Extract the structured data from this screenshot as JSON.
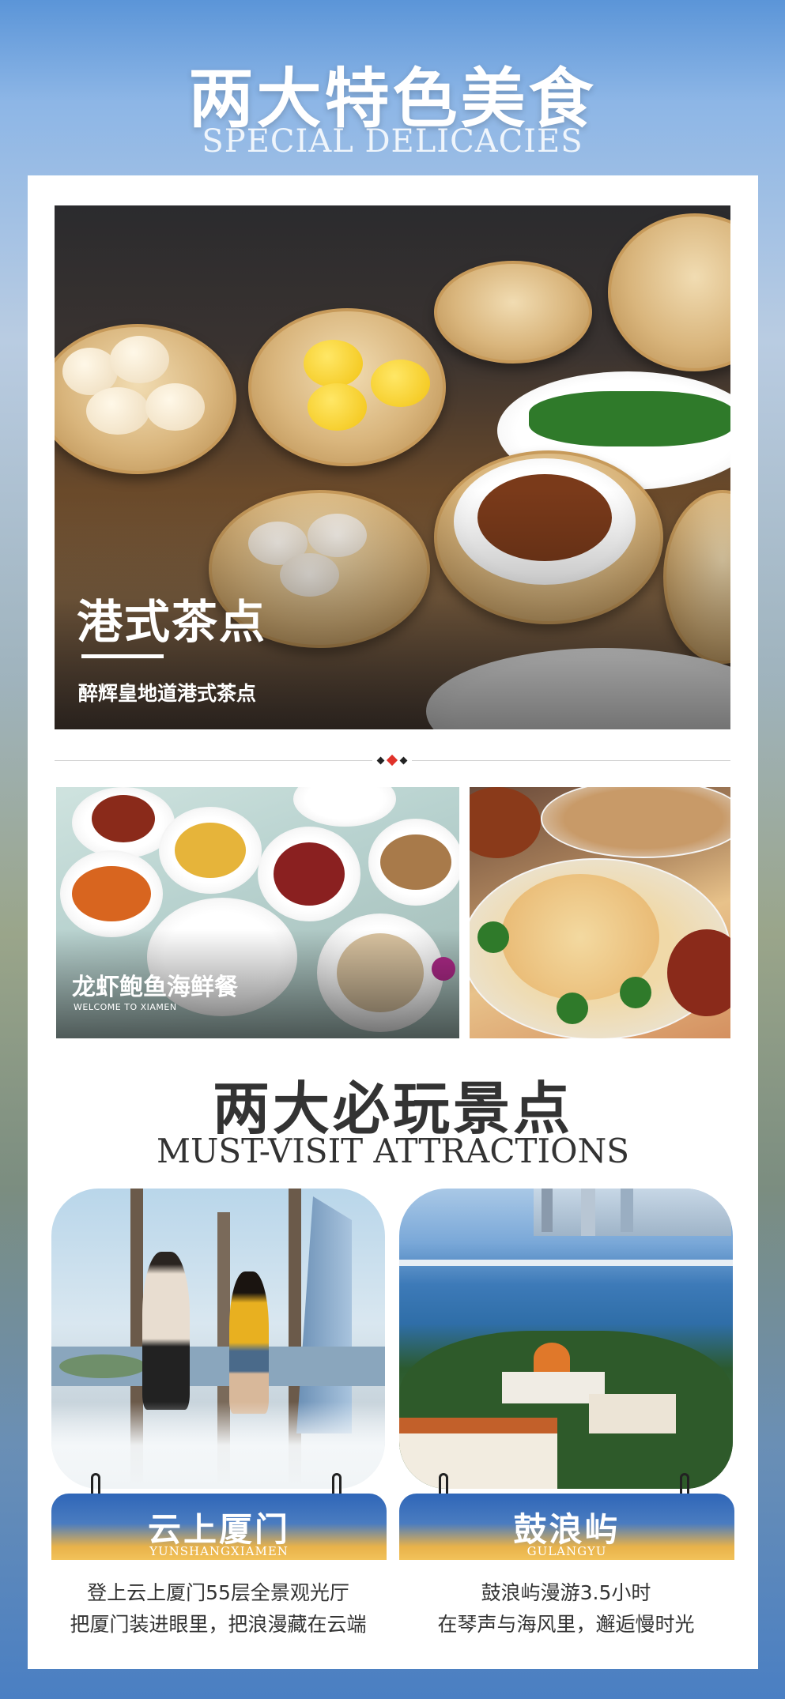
{
  "header": {
    "title": "两大特色美食",
    "subtitle": "SPECIAL DELICACIES"
  },
  "dimsum": {
    "title": "港式茶点",
    "description": "醉辉皇地道港式茶点"
  },
  "seafood": {
    "title": "龙虾鲍鱼海鲜餐",
    "subtitle": "WELCOME TO XIAMEN"
  },
  "attractions": {
    "title": "两大必玩景点",
    "subtitle": "MUST-VISIT ATTRACTIONS",
    "items": [
      {
        "name": "云上厦门",
        "name_en": "YUNSHANGXIAMEN",
        "line1": "登上云上厦门55层全景观光厅",
        "line2": "把厦门装进眼里，把浪漫藏在云端"
      },
      {
        "name": "鼓浪屿",
        "name_en": "GULANGYU",
        "line1": "鼓浪屿漫游3.5小时",
        "line2": "在琴声与海风里，邂逅慢时光"
      }
    ]
  },
  "colors": {
    "accent_red": "#e0322a",
    "banner_blue": "#2f66b8",
    "banner_gold": "#f2c25a",
    "text_dark": "#333333"
  }
}
